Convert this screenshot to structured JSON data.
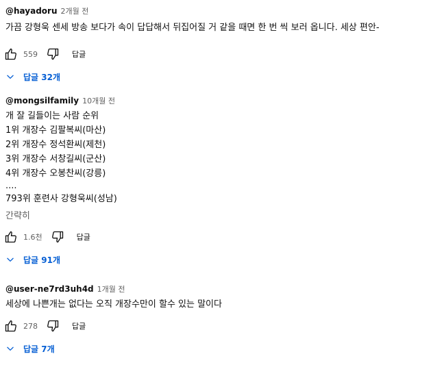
{
  "comments": [
    {
      "author": "@hayadoru",
      "time": "2개월 전",
      "lines": [
        "가끔 강형욱 센세 방송 보다가 속이 답답해서 뒤집어질 거 같을 때면 한 번 씩 보러 옵니다. 세상 편안-"
      ],
      "likes": "559",
      "reply_label": "답글",
      "replies_label": "답글 32개",
      "icons": {
        "like": "thumbs-up-icon",
        "dislike": "thumbs-down-icon",
        "expand": "chevron-down-icon"
      }
    },
    {
      "author": "@mongsilfamily",
      "time": "10개월 전",
      "lines": [
        "개 잘 길들이는 사람 순위",
        "1위 개장수 김팔복씨(마산)",
        "2위 개장수 정석환씨(제천)",
        "3위 개장수 서창길씨(군산)",
        "4위 개장수 오봉찬씨(강릉)",
        "....",
        "793위 훈련사 강형욱씨(성남)"
      ],
      "collapse_label": "간략히",
      "likes": "1.6천",
      "reply_label": "답글",
      "replies_label": "답글 91개",
      "icons": {
        "like": "thumbs-up-icon",
        "dislike": "thumbs-down-icon",
        "expand": "chevron-down-icon"
      }
    },
    {
      "author": "@user-ne7rd3uh4d",
      "time": "1개월 전",
      "lines": [
        "세상에 나쁜개는 없다는 오직 개장수만이 할수 있는 말이다"
      ],
      "likes": "278",
      "reply_label": "답글",
      "replies_label": "답글 7개",
      "icons": {
        "like": "thumbs-up-icon",
        "dislike": "thumbs-down-icon",
        "expand": "chevron-down-icon"
      }
    }
  ],
  "colors": {
    "text": "#0f0f0f",
    "secondary": "#606060",
    "link": "#065fd4",
    "background": "#ffffff"
  }
}
